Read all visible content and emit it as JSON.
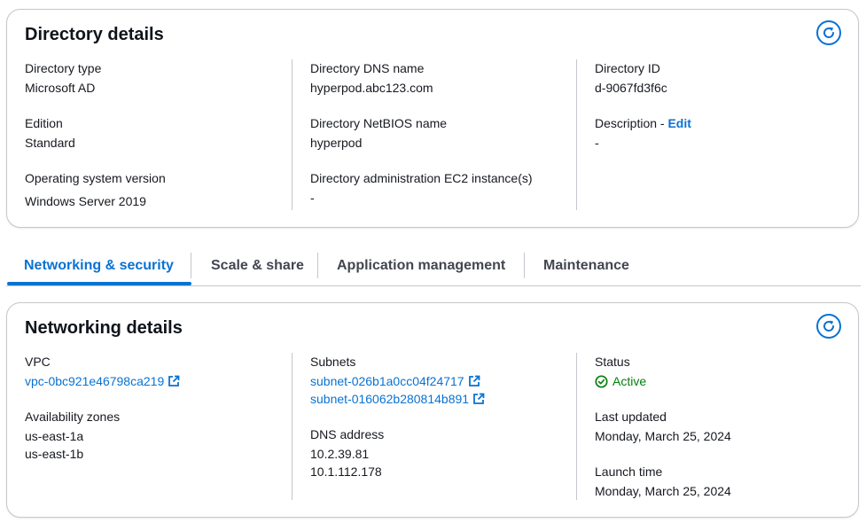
{
  "directory_details": {
    "title": "Directory details",
    "col1": {
      "type_label": "Directory type",
      "type_value": "Microsoft AD",
      "edition_label": "Edition",
      "edition_value": "Standard",
      "os_label": "Operating system version",
      "os_value": "Windows Server 2019"
    },
    "col2": {
      "dns_label": "Directory DNS name",
      "dns_value": "hyperpod.abc123.com",
      "netbios_label": "Directory NetBIOS name",
      "netbios_value": "hyperpod",
      "admin_label": "Directory administration EC2 instance(s)",
      "admin_value": "-"
    },
    "col3": {
      "id_label": "Directory ID",
      "id_value": "d-9067fd3f6c",
      "description_label": "Description - ",
      "edit_label": "Edit",
      "description_value": "-"
    }
  },
  "tabs": [
    {
      "label": "Networking & security",
      "active": true
    },
    {
      "label": "Scale & share",
      "active": false
    },
    {
      "label": "Application management",
      "active": false
    },
    {
      "label": "Maintenance",
      "active": false
    }
  ],
  "networking_details": {
    "title": "Networking details",
    "col1": {
      "vpc_label": "VPC",
      "vpc_value": "vpc-0bc921e46798ca219",
      "az_label": "Availability zones",
      "az_values": [
        "us-east-1a",
        "us-east-1b"
      ]
    },
    "col2": {
      "subnets_label": "Subnets",
      "subnets": [
        "subnet-026b1a0cc04f24717",
        "subnet-016062b280814b891"
      ],
      "dns_label": "DNS address",
      "dns_values": [
        "10.2.39.81",
        "10.1.112.178"
      ]
    },
    "col3": {
      "status_label": "Status",
      "status_value": "Active",
      "last_updated_label": "Last updated",
      "last_updated_value": "Monday, March 25, 2024",
      "launch_time_label": "Launch time",
      "launch_time_value": "Monday, March 25, 2024"
    }
  },
  "colors": {
    "link": "#0972d3",
    "success": "#037f0c",
    "border": "#c6c6cd"
  },
  "icons": [
    "refresh-icon",
    "external-link-icon",
    "status-positive-icon"
  ]
}
